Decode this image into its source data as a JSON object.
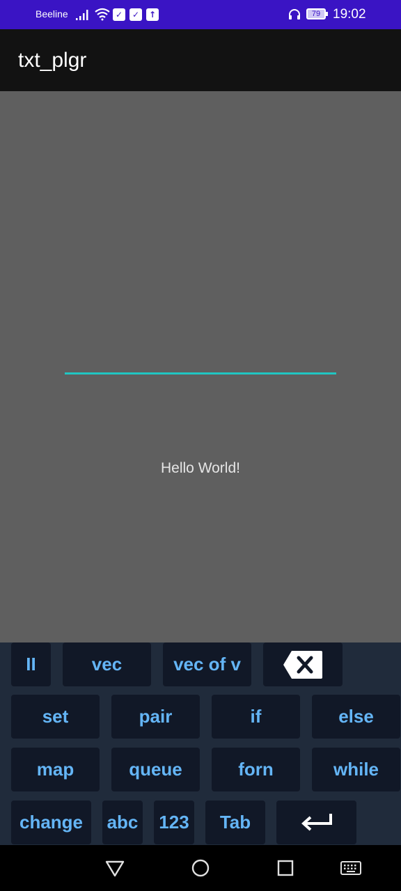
{
  "status_bar": {
    "carrier": "Beeline",
    "notification_icons": [
      "check-icon",
      "check-icon",
      "upload-icon"
    ],
    "battery": "79",
    "time": "19:02"
  },
  "app_bar": {
    "title": "txt_plgr"
  },
  "content": {
    "text_input_value": "",
    "greeting": "Hello World!"
  },
  "keyboard": {
    "row1": [
      "II",
      "vec",
      "vec of v"
    ],
    "row2": [
      "set",
      "pair",
      "if",
      "else"
    ],
    "row3": [
      "map",
      "queue",
      "forn",
      "while"
    ],
    "row4": [
      "change",
      "abc",
      "123",
      "Tab"
    ],
    "special_keys": [
      "backspace-icon",
      "enter-icon"
    ]
  },
  "nav_bar": {
    "buttons": [
      "back-icon",
      "home-icon",
      "recents-icon",
      "keyboard-icon"
    ]
  }
}
